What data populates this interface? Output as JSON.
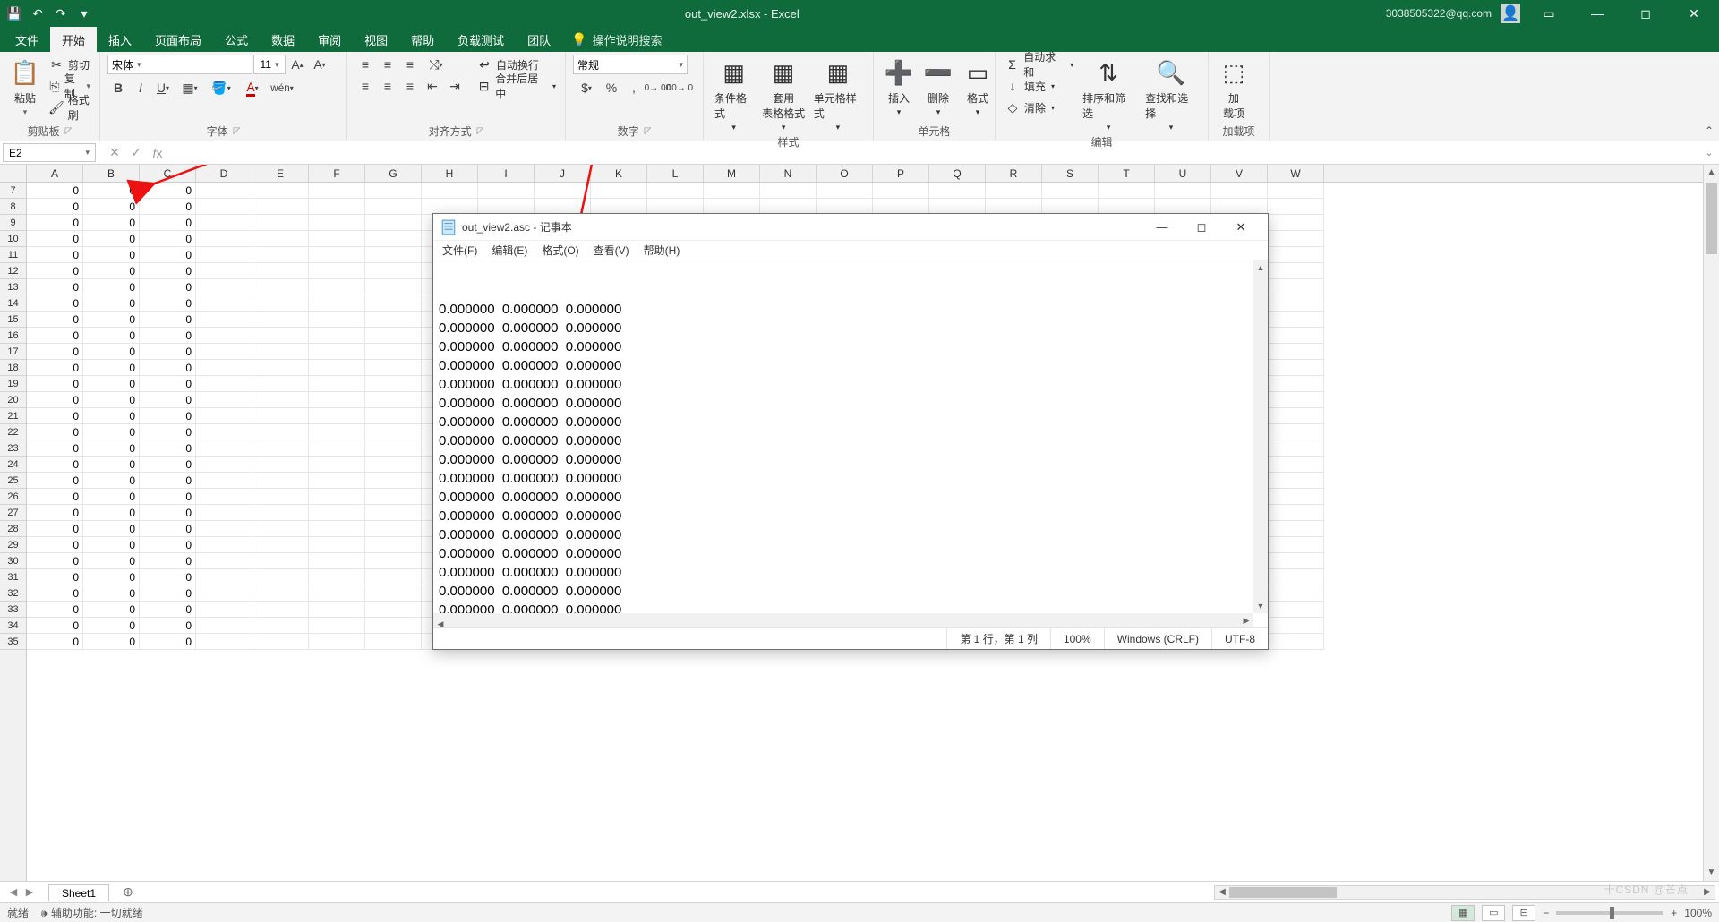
{
  "title": {
    "document": "out_view2.xlsx",
    "app": "Excel",
    "full": "out_view2.xlsx  -  Excel"
  },
  "user": {
    "email": "3038505322@qq.com"
  },
  "tabs": {
    "file": "文件",
    "home": "开始",
    "insert": "插入",
    "layout": "页面布局",
    "formulas": "公式",
    "data": "数据",
    "review": "审阅",
    "view": "视图",
    "help": "帮助",
    "loadtest": "负载测试",
    "team": "团队",
    "tellme": "操作说明搜索"
  },
  "ribbon": {
    "clipboard": {
      "label": "剪贴板",
      "paste": "粘贴",
      "cut": "剪切",
      "copy": "复制",
      "format_painter": "格式刷"
    },
    "font": {
      "label": "字体",
      "name": "宋体",
      "size": "11"
    },
    "alignment": {
      "label": "对齐方式",
      "wrap": "自动换行",
      "merge": "合并后居中"
    },
    "number": {
      "label": "数字",
      "format": "常规"
    },
    "styles": {
      "label": "样式",
      "conditional": "条件格式",
      "table": "套用\n表格格式",
      "cell": "单元格样式"
    },
    "cells": {
      "label": "单元格",
      "insert": "插入",
      "delete": "删除",
      "format": "格式"
    },
    "editing": {
      "label": "编辑",
      "autosum": "自动求和",
      "fill": "填充",
      "clear": "清除",
      "sort": "排序和筛选",
      "find": "查找和选择"
    },
    "addins": {
      "label": "加载项",
      "addin": "加\n载项"
    }
  },
  "namebox": "E2",
  "columns": [
    "A",
    "B",
    "C",
    "D",
    "E",
    "F",
    "G",
    "H",
    "I",
    "J",
    "K",
    "L",
    "M",
    "N",
    "O",
    "P",
    "Q",
    "R",
    "S",
    "T",
    "U",
    "V",
    "W"
  ],
  "first_row": 7,
  "last_row": 35,
  "cell_value": "0",
  "sheet": {
    "name": "Sheet1"
  },
  "status": {
    "ready": "就绪",
    "acc": "辅助功能: 一切就绪",
    "zoom": "100%"
  },
  "notepad": {
    "title": "out_view2.asc - 记事本",
    "menus": {
      "file": "文件(F)",
      "edit": "编辑(E)",
      "format": "格式(O)",
      "view": "查看(V)",
      "help": "帮助(H)"
    },
    "line": "0.000000  0.000000  0.000000",
    "line_count": 18,
    "status": {
      "pos": "第 1 行，第 1 列",
      "zoom": "100%",
      "eol": "Windows (CRLF)",
      "enc": "UTF-8"
    }
  },
  "watermark": "十CSDN @芒点"
}
